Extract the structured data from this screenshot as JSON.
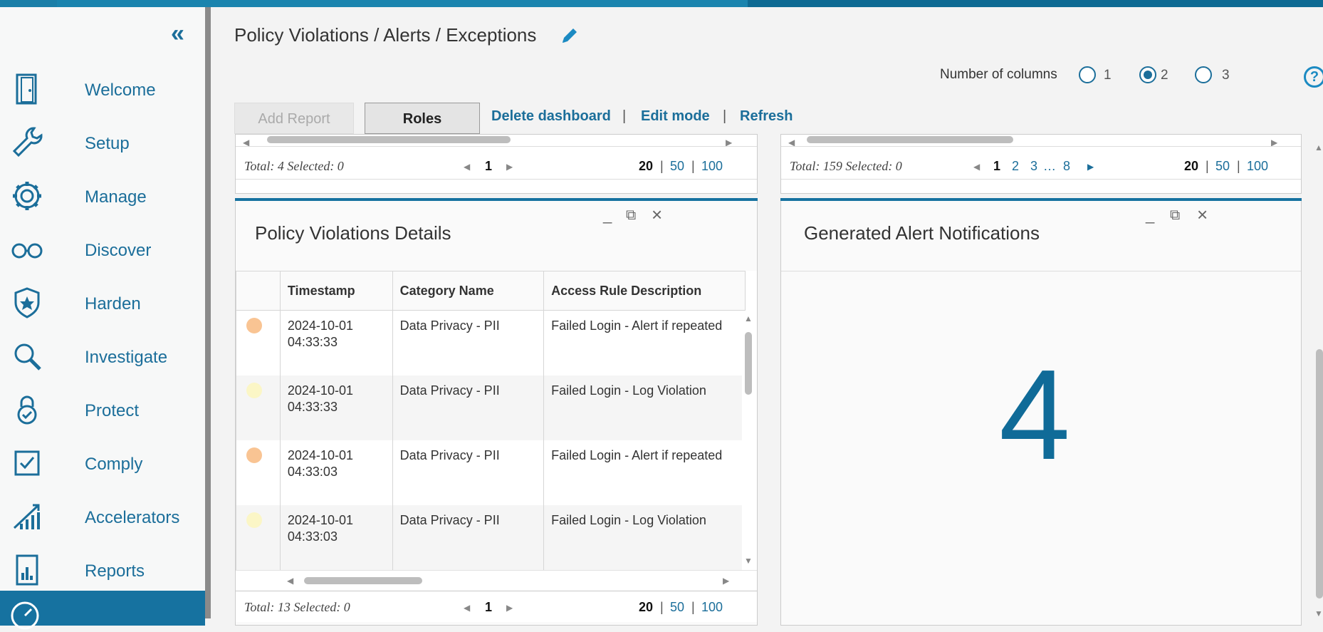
{
  "sidebar": {
    "collapse_label": "«",
    "items": [
      {
        "label": "Welcome",
        "icon": "door-icon"
      },
      {
        "label": "Setup",
        "icon": "wrench-icon"
      },
      {
        "label": "Manage",
        "icon": "gear-icon"
      },
      {
        "label": "Discover",
        "icon": "glasses-icon"
      },
      {
        "label": "Harden",
        "icon": "shield-star-icon"
      },
      {
        "label": "Investigate",
        "icon": "magnifier-icon"
      },
      {
        "label": "Protect",
        "icon": "lock-check-icon"
      },
      {
        "label": "Comply",
        "icon": "checkbox-icon"
      },
      {
        "label": "Accelerators",
        "icon": "chart-up-icon"
      },
      {
        "label": "Reports",
        "icon": "report-icon"
      }
    ],
    "accent_color": "#1672a0"
  },
  "header": {
    "title": "Policy Violations / Alerts / Exceptions",
    "columns_label": "Number of columns",
    "column_options": [
      "1",
      "2",
      "3"
    ],
    "selected_columns": "2",
    "help_label": "?"
  },
  "toolbar": {
    "add_report": "Add Report",
    "roles": "Roles",
    "delete_dashboard": "Delete dashboard",
    "edit_mode": "Edit mode",
    "refresh": "Refresh",
    "sep": "|"
  },
  "top_left_pager": {
    "total": "Total: 4 Selected: 0",
    "page": "1",
    "sizes": [
      "20",
      "50",
      "100"
    ]
  },
  "top_right_pager": {
    "total": "Total: 159 Selected: 0",
    "pages": [
      "1",
      "2",
      "3",
      "…",
      "8"
    ],
    "sizes": [
      "20",
      "50",
      "100"
    ]
  },
  "violations": {
    "title": "Policy Violations Details",
    "columns": [
      "Timestamp",
      "Category Name",
      "Access Rule Description"
    ],
    "rows": [
      {
        "severity_color": "#f9c493",
        "timestamp_date": "2024-10-01",
        "timestamp_time": "04:33:33",
        "category": "Data Privacy - PII",
        "rule": "Failed Login - Alert if repeated"
      },
      {
        "severity_color": "#fbf6c6",
        "timestamp_date": "2024-10-01",
        "timestamp_time": "04:33:33",
        "category": "Data Privacy - PII",
        "rule": "Failed Login - Log Violation"
      },
      {
        "severity_color": "#f9c493",
        "timestamp_date": "2024-10-01",
        "timestamp_time": "04:33:03",
        "category": "Data Privacy - PII",
        "rule": "Failed Login - Alert if repeated"
      },
      {
        "severity_color": "#fbf6c6",
        "timestamp_date": "2024-10-01",
        "timestamp_time": "04:33:03",
        "category": "Data Privacy - PII",
        "rule": "Failed Login - Log Violation"
      }
    ],
    "pager": {
      "total": "Total: 13 Selected: 0",
      "page": "1",
      "sizes": [
        "20",
        "50",
        "100"
      ]
    }
  },
  "alerts": {
    "title": "Generated Alert Notifications",
    "count": "4"
  },
  "widget_controls": {
    "minimize": "_",
    "maximize": "⧉",
    "close": "×"
  }
}
